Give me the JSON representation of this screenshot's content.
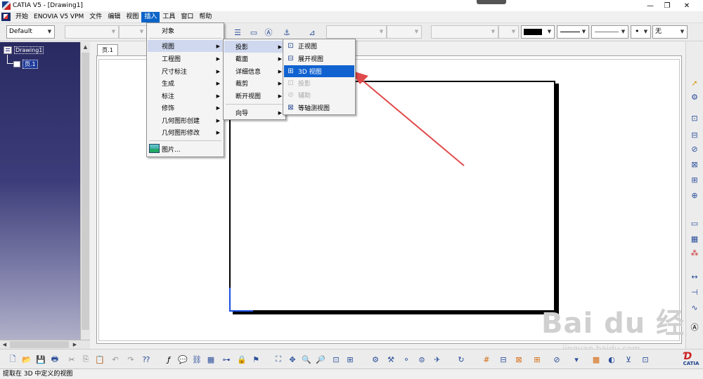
{
  "window": {
    "title": "CATIA V5 - [Drawing1]",
    "controls": {
      "minimize": "—",
      "maximize": "❐",
      "close": "✕"
    }
  },
  "menubar": {
    "items": [
      "开始",
      "ENOVIA V5 VPM",
      "文件",
      "编辑",
      "视图",
      "插入",
      "工具",
      "窗口",
      "帮助"
    ],
    "active": "插入"
  },
  "toolbar": {
    "style_combo": "Default",
    "fill_combo": "无"
  },
  "tree": {
    "root": "Drawing1",
    "child": "页.1"
  },
  "sheet_tab": "页.1",
  "insert_menu": {
    "items": [
      "对象",
      "视图",
      "工程图",
      "尺寸标注",
      "生成",
      "标注",
      "修饰",
      "几何图形创建",
      "几何图形修改",
      "图片..."
    ]
  },
  "view_submenu": {
    "items": [
      "投影",
      "截面",
      "详细信息",
      "裁剪",
      "断开视图",
      "向导"
    ]
  },
  "projection_submenu": {
    "items": [
      "正视图",
      "展开视图",
      "3D 视图",
      "投影",
      "辅助",
      "等轴测视图"
    ],
    "selected": "3D 视图"
  },
  "status_bar": "提取在 3D 中定义的视图",
  "watermark": {
    "main": "Bai du 经验",
    "url": "jingyan.baidu.com"
  },
  "logo": "CATIA",
  "colors": {
    "selection": "#1062d0",
    "annotation_arrow": "#e04a4a",
    "axis": "#1a4ee0"
  }
}
